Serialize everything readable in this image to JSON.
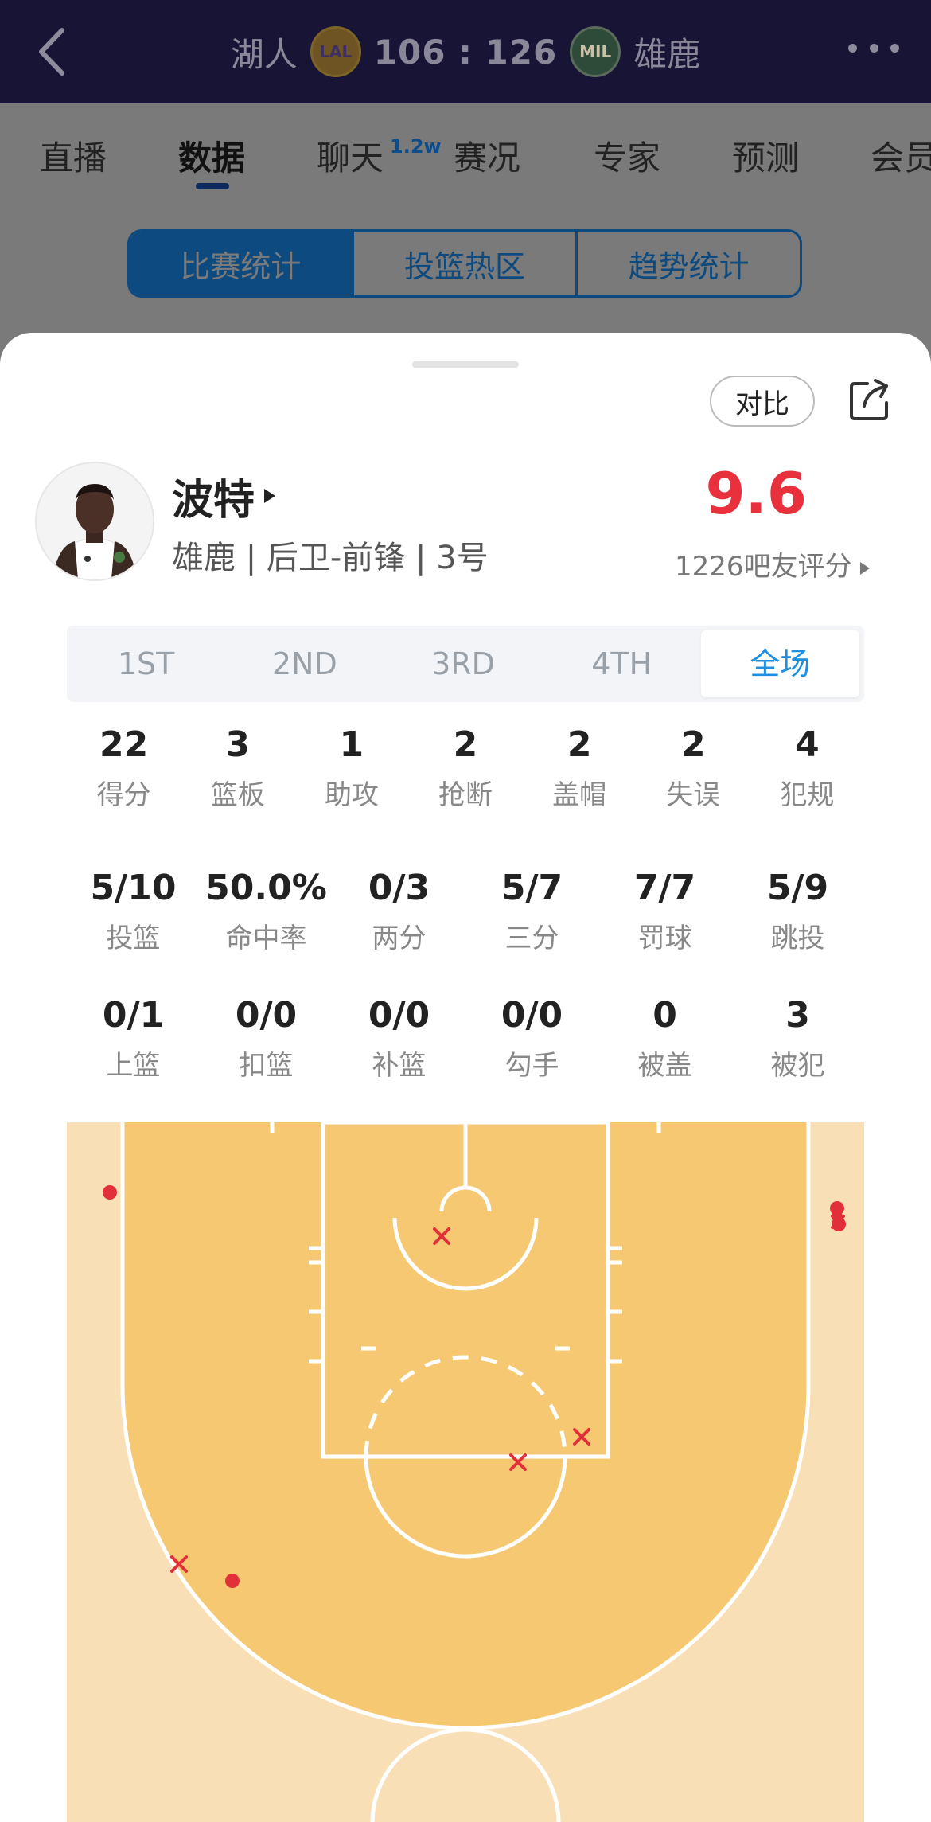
{
  "header": {
    "home_team": "湖人",
    "home_abbr": "LAL",
    "score": "106 : 126",
    "away_abbr": "MIL",
    "away_team": "雄鹿"
  },
  "tabs": [
    {
      "label": "直播"
    },
    {
      "label": "数据"
    },
    {
      "label": "聊天",
      "badge": "1.2w"
    },
    {
      "label": "赛况"
    },
    {
      "label": "专家"
    },
    {
      "label": "预测"
    },
    {
      "label": "会员"
    }
  ],
  "segments": [
    "比赛统计",
    "投篮热区",
    "趋势统计"
  ],
  "sheet": {
    "compare_label": "对比",
    "player": {
      "name": "波特",
      "info": "雄鹿 | 后卫-前锋 | 3号",
      "rating": "9.6",
      "rating_count": "1226吧友评分"
    },
    "periods": [
      "1ST",
      "2ND",
      "3RD",
      "4TH",
      "全场"
    ],
    "stats_row1": [
      {
        "value": "22",
        "label": "得分"
      },
      {
        "value": "3",
        "label": "篮板"
      },
      {
        "value": "1",
        "label": "助攻"
      },
      {
        "value": "2",
        "label": "抢断"
      },
      {
        "value": "2",
        "label": "盖帽"
      },
      {
        "value": "2",
        "label": "失误"
      },
      {
        "value": "4",
        "label": "犯规"
      }
    ],
    "stats_row2": [
      {
        "value": "5/10",
        "label": "投篮"
      },
      {
        "value": "50.0%",
        "label": "命中率"
      },
      {
        "value": "0/3",
        "label": "两分"
      },
      {
        "value": "5/7",
        "label": "三分"
      },
      {
        "value": "7/7",
        "label": "罚球"
      },
      {
        "value": "5/9",
        "label": "跳投"
      }
    ],
    "stats_row3": [
      {
        "value": "0/1",
        "label": "上篮"
      },
      {
        "value": "0/0",
        "label": "扣篮"
      },
      {
        "value": "0/0",
        "label": "补篮"
      },
      {
        "value": "0/0",
        "label": "勾手"
      },
      {
        "value": "0",
        "label": "被盖"
      },
      {
        "value": "3",
        "label": "被犯"
      }
    ]
  },
  "colors": {
    "rating": "#e8313c",
    "active_period": "#1e8fe1",
    "court_paint": "#f6c872",
    "court_outside": "#f8dfb6",
    "shot_marker": "#e2303a"
  },
  "icons": [
    "back-arrow-icon",
    "more-icon",
    "share-icon",
    "play-arrow-icon"
  ]
}
